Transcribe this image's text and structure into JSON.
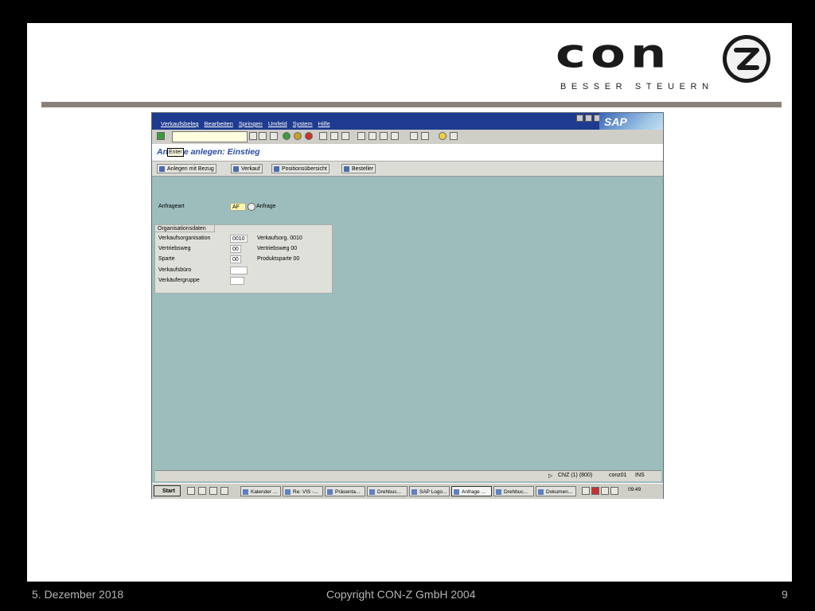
{
  "slide": {
    "logo_text": "con",
    "logo_tagline": "BESSER STEUERN",
    "footer_date": "5. Dezember 2018",
    "footer_copyright": "Copyright CON-Z GmbH 2004",
    "footer_page": "9"
  },
  "sap": {
    "menu": [
      "Verkaufsbeleg",
      "Bearbeiten",
      "Springen",
      "Umfeld",
      "System",
      "Hilfe"
    ],
    "brand": "SAP",
    "tooltip": "Enter",
    "title": "Anfrage anlegen: Einstieg",
    "app_buttons": [
      "Anlegen mit Bezug",
      "Verkauf",
      "Positionsübersicht",
      "Besteller"
    ],
    "anfrageart_label": "Anfrageart",
    "anfrageart_value": "AF",
    "anfrageart_desc": "Anfrage",
    "group_title": "Organisationsdaten",
    "org_rows": [
      {
        "label": "Verkaufsorganisation",
        "value": "0010",
        "desc": "Verkaufsorg. 0010"
      },
      {
        "label": "Vertriebsweg",
        "value": "00",
        "desc": "Vertriebsweg 00"
      },
      {
        "label": "Sparte",
        "value": "00",
        "desc": "Produktsparte 00"
      },
      {
        "label": "Verkaufsbüro",
        "value": "",
        "desc": ""
      },
      {
        "label": "Verkäufergruppe",
        "value": "",
        "desc": ""
      }
    ],
    "status": {
      "system": "CNZ (1) (800)",
      "user": "conz01",
      "mode": "INS"
    }
  },
  "taskbar": {
    "start": "Start",
    "tasks": [
      "Kalender ...",
      "Re: VIS -...",
      "Präsenta...",
      "Drehbuc...",
      "SAP Logo...",
      "Anfrage ...",
      "Drehbuc...",
      "Dokumen..."
    ],
    "active_index": 5,
    "clock": "09:49"
  }
}
